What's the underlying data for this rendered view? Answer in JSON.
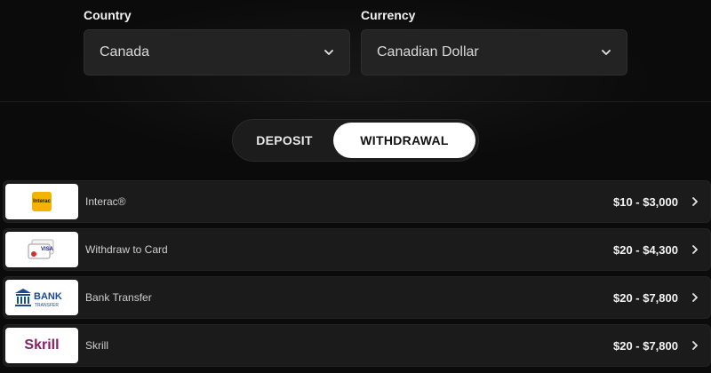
{
  "country": {
    "label": "Country",
    "value": "Canada"
  },
  "currency": {
    "label": "Currency",
    "value": "Canadian Dollar"
  },
  "tabs": {
    "deposit": "DEPOSIT",
    "withdrawal": "WITHDRAWAL",
    "active": "withdrawal"
  },
  "methods": [
    {
      "name": "Interac®",
      "range": "$10 - $3,000",
      "logo": "interac-logo",
      "logo_text": "Interac"
    },
    {
      "name": "Withdraw to Card",
      "range": "$20 - $4,300",
      "logo": "card-logo",
      "logo_text": "VISA"
    },
    {
      "name": "Bank Transfer",
      "range": "$20 - $7,800",
      "logo": "bank-transfer-logo",
      "logo_text": "BANK",
      "logo_subtext": "TRANSFER"
    },
    {
      "name": "Skrill",
      "range": "$20 - $7,800",
      "logo": "skrill-logo",
      "logo_text": "Skrill"
    }
  ],
  "colors": {
    "background": "#0b0b0b",
    "panel": "#1b1b1b",
    "skrill": "#862165",
    "bank": "#1c4a8f",
    "interac": "#f2b400"
  }
}
